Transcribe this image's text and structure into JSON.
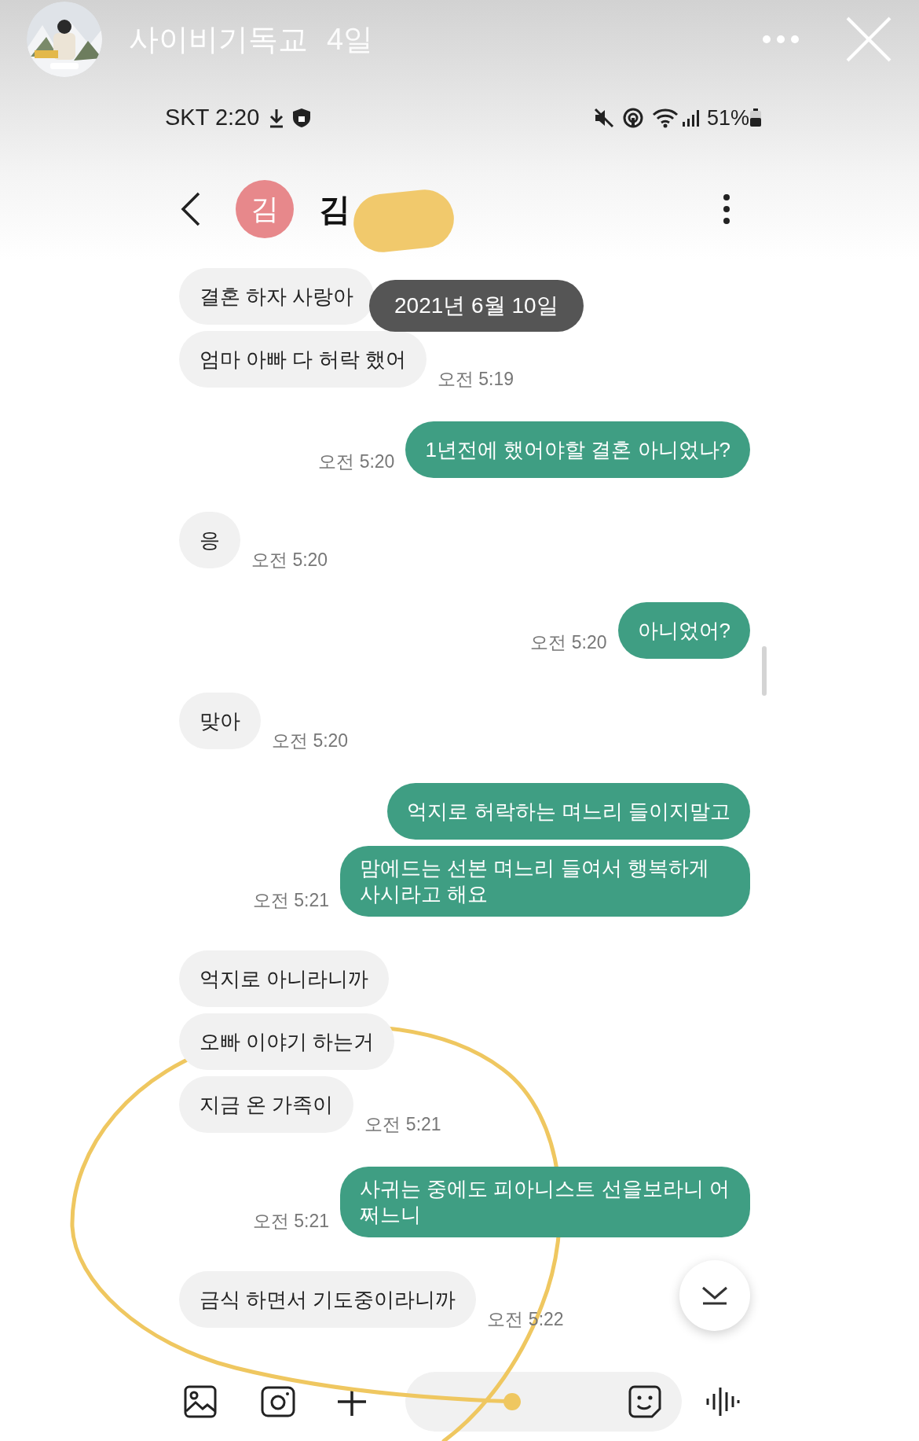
{
  "story": {
    "account": "사이비기독교",
    "age": "4일"
  },
  "status_bar": {
    "carrier_time": "SKT 2:20",
    "battery": "51%"
  },
  "chat_header": {
    "avatar_initial": "김",
    "contact_name": "김"
  },
  "date_badge": "2021년 6월 10일",
  "messages": [
    {
      "outgoing": false,
      "text": "결혼 하자 사랑아"
    },
    {
      "outgoing": false,
      "text": "엄마 아빠 다 허락 했어",
      "time": "오전 5:19"
    },
    {
      "outgoing": true,
      "text": "1년전에 했어야할 결혼 아니었나?",
      "time": "오전 5:20"
    },
    {
      "outgoing": false,
      "text": "응",
      "time": "오전 5:20"
    },
    {
      "outgoing": true,
      "text": "아니었어?",
      "time": "오전 5:20"
    },
    {
      "outgoing": false,
      "text": "맞아",
      "time": "오전 5:20"
    },
    {
      "outgoing": true,
      "text": "억지로 허락하는 며느리 들이지말고"
    },
    {
      "outgoing": true,
      "text": "맘에드는 선본 며느리 들여서 행복하게 사시라고 해요",
      "time": "오전 5:21"
    },
    {
      "outgoing": false,
      "text": "억지로 아니라니까"
    },
    {
      "outgoing": false,
      "text": "오빠 이야기 하는거"
    },
    {
      "outgoing": false,
      "text": "지금 온 가족이",
      "time": "오전 5:21"
    },
    {
      "outgoing": true,
      "text": "사귀는 중에도 피아니스트 선을보라니 어쩌느니",
      "time": "오전 5:21"
    },
    {
      "outgoing": false,
      "text": "금식 하면서 기도중이라니까",
      "time": "오전 5:22"
    }
  ]
}
